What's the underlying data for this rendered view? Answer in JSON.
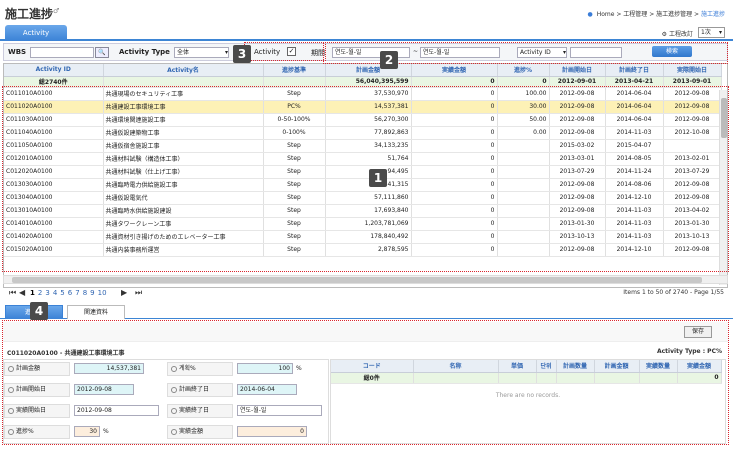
{
  "header": {
    "title": "施工進捗",
    "title_sup": "♂",
    "breadcrumb": [
      "Home",
      "工程管理",
      "施工進捗管理",
      "施工進捗"
    ]
  },
  "tabs": {
    "activity": "Activity"
  },
  "revision": {
    "label": "工程改訂",
    "value": "1次"
  },
  "filter": {
    "wbs_label": "WBS",
    "activity_type_label": "Activity Type",
    "activity_type_value": "全体",
    "activity_check_label": "Activity",
    "period_label": "期間",
    "date_from_placeholder": "연도-월-일",
    "date_sep": "~",
    "date_to_placeholder": "연도-월-일",
    "activity_id_select": "Activity ID",
    "search_button": "検索"
  },
  "grid": {
    "columns": [
      "Activity ID",
      "Activity名",
      "進捗基準",
      "計画金額",
      "実績金額",
      "進捗%",
      "計画開始日",
      "計画終了日",
      "実際開始日"
    ],
    "summary": {
      "label": "総2740件",
      "plan": "56,040,395,599",
      "actual": "0",
      "pct": "0",
      "start": "2012-09-01",
      "end": "2013-04-21",
      "real": "2013-09-01"
    },
    "rows": [
      {
        "id": "C011010A0100",
        "name": "共通現場のセキュリティ工事",
        "basis": "Step",
        "plan": "37,530,970",
        "actual": "0",
        "pct": "100.00",
        "s": "2012-09-08",
        "e": "2014-06-04",
        "r": "2012-09-08"
      },
      {
        "id": "C011020A0100",
        "name": "共通建設工事環境工事",
        "basis": "PC%",
        "plan": "14,537,381",
        "actual": "0",
        "pct": "30.00",
        "s": "2012-09-08",
        "e": "2014-06-04",
        "r": "2012-09-08"
      },
      {
        "id": "C011030A0100",
        "name": "共通環境関連施設工事",
        "basis": "0-50-100%",
        "plan": "56,270,300",
        "actual": "0",
        "pct": "50.00",
        "s": "2012-09-08",
        "e": "2014-06-04",
        "r": "2012-09-08"
      },
      {
        "id": "C011040A0100",
        "name": "共通仮設建築物工事",
        "basis": "0-100%",
        "plan": "77,892,863",
        "actual": "0",
        "pct": "0.00",
        "s": "2012-09-08",
        "e": "2014-11-03",
        "r": "2012-10-08"
      },
      {
        "id": "C011050A0100",
        "name": "共通仮宿舎施設工事",
        "basis": "Step",
        "plan": "34,133,235",
        "actual": "0",
        "pct": "",
        "s": "2015-03-02",
        "e": "2015-04-07",
        "r": ""
      },
      {
        "id": "C012010A0100",
        "name": "共通材料試験（構造体工事）",
        "basis": "Step",
        "plan": "51,764",
        "actual": "0",
        "pct": "",
        "s": "2013-03-01",
        "e": "2014-08-05",
        "r": "2013-02-01"
      },
      {
        "id": "C012020A0100",
        "name": "共通材料試験（仕上げ工事）",
        "basis": "Step",
        "plan": "94,495",
        "actual": "0",
        "pct": "",
        "s": "2013-07-29",
        "e": "2014-11-24",
        "r": "2013-07-29"
      },
      {
        "id": "C013030A0100",
        "name": "共通臨時電力供給施設工事",
        "basis": "Step",
        "plan": "83,541,315",
        "actual": "0",
        "pct": "",
        "s": "2012-09-08",
        "e": "2014-08-06",
        "r": "2012-09-08"
      },
      {
        "id": "C013040A0100",
        "name": "共通仮設電気代",
        "basis": "Step",
        "plan": "57,111,860",
        "actual": "0",
        "pct": "",
        "s": "2012-09-08",
        "e": "2014-12-10",
        "r": "2012-09-08"
      },
      {
        "id": "C013010A0100",
        "name": "共通臨時水供給施設建設",
        "basis": "Step",
        "plan": "17,693,840",
        "actual": "0",
        "pct": "",
        "s": "2012-09-08",
        "e": "2014-11-03",
        "r": "2013-04-02"
      },
      {
        "id": "C014010A0100",
        "name": "共通タワークレーン工事",
        "basis": "Step",
        "plan": "1,203,781,069",
        "actual": "0",
        "pct": "",
        "s": "2013-01-30",
        "e": "2014-11-03",
        "r": "2013-01-30"
      },
      {
        "id": "C014020A0100",
        "name": "共通資材引き揚げのためのエレベーター工事",
        "basis": "Step",
        "plan": "178,840,492",
        "actual": "0",
        "pct": "",
        "s": "2013-10-13",
        "e": "2014-11-03",
        "r": "2013-10-13"
      },
      {
        "id": "C015020A0100",
        "name": "共通内装事務所運営",
        "basis": "Step",
        "plan": "2,878,595",
        "actual": "0",
        "pct": "",
        "s": "2012-09-08",
        "e": "2014-12-10",
        "r": "2012-09-08"
      }
    ]
  },
  "pager": {
    "pages": [
      "1",
      "2",
      "3",
      "4",
      "5",
      "6",
      "7",
      "8",
      "9",
      "10"
    ],
    "info": "Items 1 to 50 of 2740 - Page 1/55"
  },
  "detail_tabs": [
    "進捗率",
    "関連資料"
  ],
  "detail": {
    "save": "保存",
    "heading": "C011020A0100 - 共通建設工事環境工事",
    "activity_type": "Activity Type :  PC%",
    "plan_amount_label": "計画金額",
    "plan_amount": "14,537,381",
    "ratio_label": "계획%",
    "ratio": "100",
    "pct_unit": "%",
    "plan_start_label": "計画開始日",
    "plan_start": "2012-09-08",
    "plan_end_label": "計画終了日",
    "plan_end": "2014-06-04",
    "real_start_label": "実績開始日",
    "real_start": "2012-09-08",
    "real_end_label": "実績終了日",
    "real_end": "연도-월-일",
    "progress_label": "進捗%",
    "progress": "30",
    "actual_amount_label": "実績金額",
    "actual_amount": "0",
    "sub_columns": [
      "コード",
      "名称",
      "単価",
      "단위",
      "計画数量",
      "計画金額",
      "実績数量",
      "実績金額"
    ],
    "sub_summary": "総0件",
    "sub_summary_val": "0",
    "no_records": "There are no records."
  },
  "annotations": [
    "1",
    "2",
    "3",
    "4"
  ]
}
